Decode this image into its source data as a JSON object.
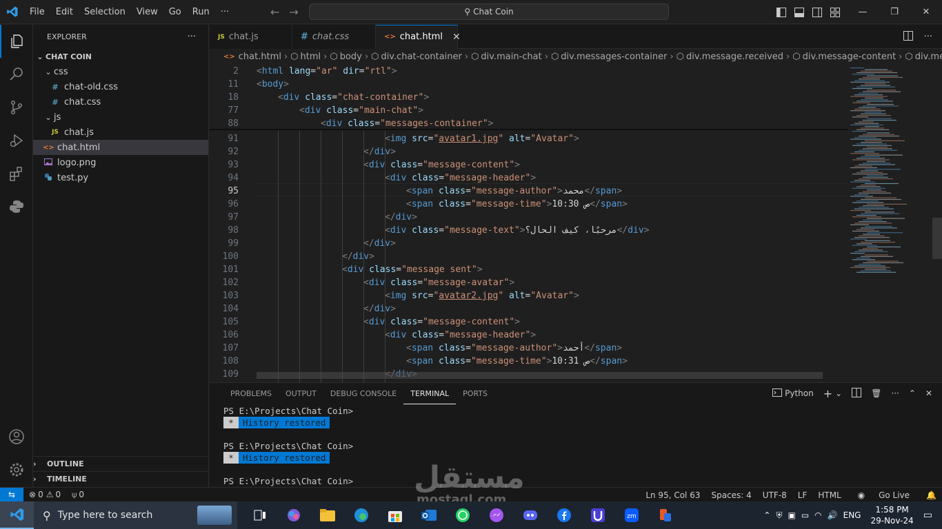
{
  "titlebar": {
    "menu": [
      "File",
      "Edit",
      "Selection",
      "View",
      "Go",
      "Run",
      "···"
    ],
    "search_text": "Chat Coin"
  },
  "sidebar": {
    "title": "EXPLORER",
    "more": "···",
    "root": "CHAT COIN",
    "items": [
      {
        "label": "css",
        "icon": "chevron-down-icon",
        "type": "folder"
      },
      {
        "label": "chat-old.css",
        "icon": "#",
        "type": "file"
      },
      {
        "label": "chat.css",
        "icon": "#",
        "type": "file"
      },
      {
        "label": "js",
        "icon": "chevron-down-icon",
        "type": "folder"
      },
      {
        "label": "chat.js",
        "icon": "JS",
        "type": "file"
      },
      {
        "label": "chat.html",
        "icon": "<>",
        "type": "file"
      },
      {
        "label": "logo.png",
        "icon": "image-icon",
        "type": "file"
      },
      {
        "label": "test.py",
        "icon": "python-icon",
        "type": "file"
      }
    ],
    "outline": "OUTLINE",
    "timeline": "TIMELINE"
  },
  "tabs": [
    {
      "label": "chat.js",
      "icon": "JS"
    },
    {
      "label": "chat.css",
      "icon": "#"
    },
    {
      "label": "chat.html",
      "icon": "<>"
    }
  ],
  "breadcrumbs": [
    "chat.html",
    "html",
    "body",
    "div.chat-container",
    "div.main-chat",
    "div.messages-container",
    "div.message.received",
    "div.message-content",
    "div.message-h"
  ],
  "code": [
    {
      "n": "2",
      "t": "<html lang=\"ar\" dir=\"rtl\">"
    },
    {
      "n": "11",
      "t": "<body>"
    },
    {
      "n": "18",
      "t": "<div class=\"chat-container\">"
    },
    {
      "n": "77",
      "t": "<div class=\"main-chat\">"
    },
    {
      "n": "88",
      "t": "<div class=\"messages-container\">"
    },
    {
      "n": "91",
      "t": "<img src=\"avatar1.jpg\" alt=\"Avatar\">"
    },
    {
      "n": "92",
      "t": "</div>"
    },
    {
      "n": "93",
      "t": "<div class=\"message-content\">"
    },
    {
      "n": "94",
      "t": "<div class=\"message-header\">"
    },
    {
      "n": "95",
      "t": "<span class=\"message-author\">محمد</span>"
    },
    {
      "n": "96",
      "t": "<span class=\"message-time\">10:30 ص</span>"
    },
    {
      "n": "97",
      "t": "</div>"
    },
    {
      "n": "98",
      "t": "<div class=\"message-text\">مرحبًا، كيف الحال؟</div>"
    },
    {
      "n": "99",
      "t": "</div>"
    },
    {
      "n": "100",
      "t": "</div>"
    },
    {
      "n": "101",
      "t": "<div class=\"message sent\">"
    },
    {
      "n": "102",
      "t": "<div class=\"message-avatar\">"
    },
    {
      "n": "103",
      "t": "<img src=\"avatar2.jpg\" alt=\"Avatar\">"
    },
    {
      "n": "104",
      "t": "</div>"
    },
    {
      "n": "105",
      "t": "<div class=\"message-content\">"
    },
    {
      "n": "106",
      "t": "<div class=\"message-header\">"
    },
    {
      "n": "107",
      "t": "<span class=\"message-author\">أحمد</span>"
    },
    {
      "n": "108",
      "t": "<span class=\"message-time\">10:31 ص</span>"
    },
    {
      "n": "109",
      "t": "</div>"
    }
  ],
  "panel": {
    "tabs": [
      "PROBLEMS",
      "OUTPUT",
      "DEBUG CONSOLE",
      "TERMINAL",
      "PORTS"
    ],
    "active_tab": "TERMINAL",
    "terminal_profile": "Python",
    "lines": [
      {
        "prompt": "PS E:\\Projects\\Chat Coin>"
      },
      {
        "badge": "History restored"
      },
      {
        "prompt": "PS E:\\Projects\\Chat Coin>"
      },
      {
        "badge": "History restored"
      },
      {
        "prompt": "PS E:\\Projects\\Chat Coin>"
      }
    ]
  },
  "statusbar": {
    "errors": "0",
    "warnings": "0",
    "ports": "0",
    "position": "Ln 95, Col 63",
    "spaces": "Spaces: 4",
    "encoding": "UTF-8",
    "eol": "LF",
    "language": "HTML",
    "live": "Go Live"
  },
  "taskbar": {
    "search_placeholder": "Type here to search",
    "lang": "ENG",
    "time": "1:58 PM",
    "date": "29-Nov-24"
  },
  "watermark": {
    "line1": "مستقل",
    "line2": "mostaql.com"
  },
  "colors": {
    "accent": "#0078d4",
    "tag": "#569cd6",
    "attr": "#9cdcfe",
    "string": "#ce9178"
  }
}
